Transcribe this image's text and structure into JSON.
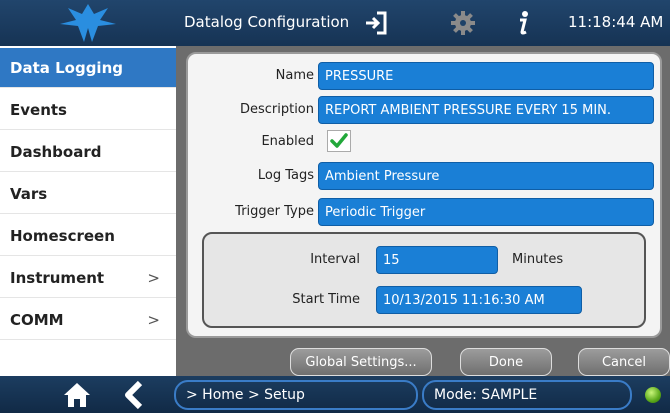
{
  "header": {
    "title": "Datalog Configuration",
    "clock": "11:18:44 AM",
    "icons": [
      "logo-icon",
      "signin-icon",
      "gear-icon",
      "info-icon"
    ]
  },
  "sidebar": {
    "items": [
      {
        "label": "Data Logging",
        "active": true,
        "chevron": ""
      },
      {
        "label": "Events",
        "active": false,
        "chevron": ""
      },
      {
        "label": "Dashboard",
        "active": false,
        "chevron": ""
      },
      {
        "label": "Vars",
        "active": false,
        "chevron": ""
      },
      {
        "label": "Homescreen",
        "active": false,
        "chevron": ""
      },
      {
        "label": "Instrument",
        "active": false,
        "chevron": ">"
      },
      {
        "label": "COMM",
        "active": false,
        "chevron": ">"
      }
    ]
  },
  "form": {
    "name_label": "Name",
    "name_value": "PRESSURE",
    "description_label": "Description",
    "description_value": "REPORT AMBIENT PRESSURE EVERY 15 MIN.",
    "enabled_label": "Enabled",
    "enabled": true,
    "log_tags_label": "Log Tags",
    "log_tags_value": "Ambient Pressure",
    "trigger_type_label": "Trigger Type",
    "trigger_type_value": "Periodic Trigger",
    "interval_label": "Interval",
    "interval_value": "15",
    "interval_unit": "Minutes",
    "start_time_label": "Start Time",
    "start_time_value": "10/13/2015 11:16:30 AM"
  },
  "buttons": {
    "global_settings": "Global Settings...",
    "done": "Done",
    "cancel": "Cancel"
  },
  "footer": {
    "breadcrumb": "> Home > Setup",
    "mode": "Mode: SAMPLE",
    "status_color": "#5aa81a"
  },
  "colors": {
    "accent": "#1a7fd6",
    "header_bg": "#1c3a5c",
    "active_item": "#2f78c4"
  }
}
